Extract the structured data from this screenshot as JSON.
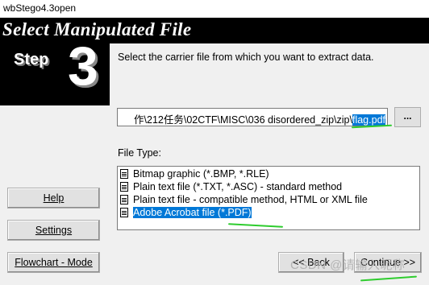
{
  "window": {
    "title": "wbStego4.3open"
  },
  "banner": {
    "title": "Select Manipulated File"
  },
  "step": {
    "word": "Step",
    "number": "3"
  },
  "main": {
    "instruction": "Select the carrier file from which you want to extract data.",
    "path_prefix": "作\\212任务\\02CTF\\MISC\\036 disordered_zip\\zip\\",
    "path_selected": "flag.pdf",
    "browse_label": "...",
    "file_type_label": "File Type:",
    "file_types": [
      "Bitmap graphic (*.BMP, *.RLE)",
      "Plain text file (*.TXT, *.ASC) - standard method",
      "Plain text file - compatible method, HTML or XML file",
      "Adobe Acrobat file (*.PDF)"
    ],
    "selected_index": 3
  },
  "buttons": {
    "help": "Help",
    "settings": "Settings",
    "flowchart": "Flowchart - Mode",
    "back": "<< Back",
    "continue": "Continue >>"
  },
  "watermark": "CSDN @请输入昵称",
  "colors": {
    "selection": "#0078d7",
    "annotation": "#2ecc2e"
  }
}
